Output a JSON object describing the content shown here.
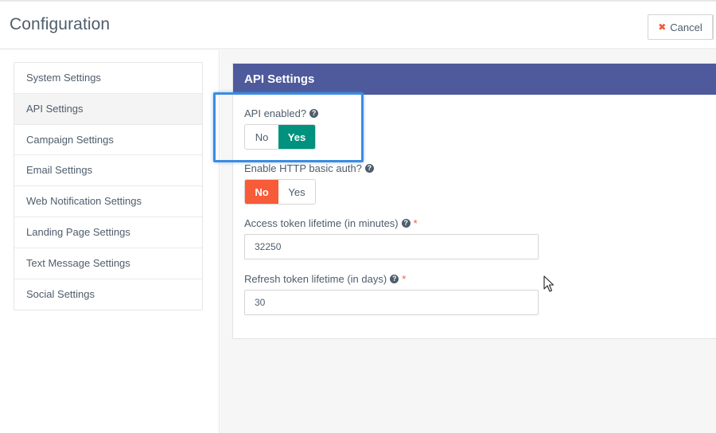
{
  "header": {
    "title": "Configuration",
    "cancel_label": "Cancel"
  },
  "sidebar": {
    "items": [
      {
        "label": "System Settings"
      },
      {
        "label": "API Settings",
        "active": true
      },
      {
        "label": "Campaign Settings"
      },
      {
        "label": "Email Settings"
      },
      {
        "label": "Web Notification Settings"
      },
      {
        "label": "Landing Page Settings"
      },
      {
        "label": "Text Message Settings"
      },
      {
        "label": "Social Settings"
      }
    ]
  },
  "panel": {
    "title": "API Settings",
    "api_enabled": {
      "label": "API enabled?",
      "no_label": "No",
      "yes_label": "Yes",
      "selected": "Yes"
    },
    "http_basic_auth": {
      "label": "Enable HTTP basic auth?",
      "no_label": "No",
      "yes_label": "Yes",
      "selected": "No"
    },
    "access_token": {
      "label": "Access token lifetime (in minutes)",
      "required_mark": "*",
      "value": "32250"
    },
    "refresh_token": {
      "label": "Refresh token lifetime (in days)",
      "required_mark": "*",
      "value": "30"
    },
    "help_glyph": "?"
  },
  "colors": {
    "heading_bg": "#4e5a9c",
    "toggle_yes_on": "#00927f",
    "toggle_no_on": "#f85b38",
    "highlight": "#3d8be0",
    "required": "#f05a3c"
  },
  "icons": {
    "cancel": "close-icon",
    "help": "question-circle-icon",
    "cursor": "mouse-pointer-icon"
  }
}
